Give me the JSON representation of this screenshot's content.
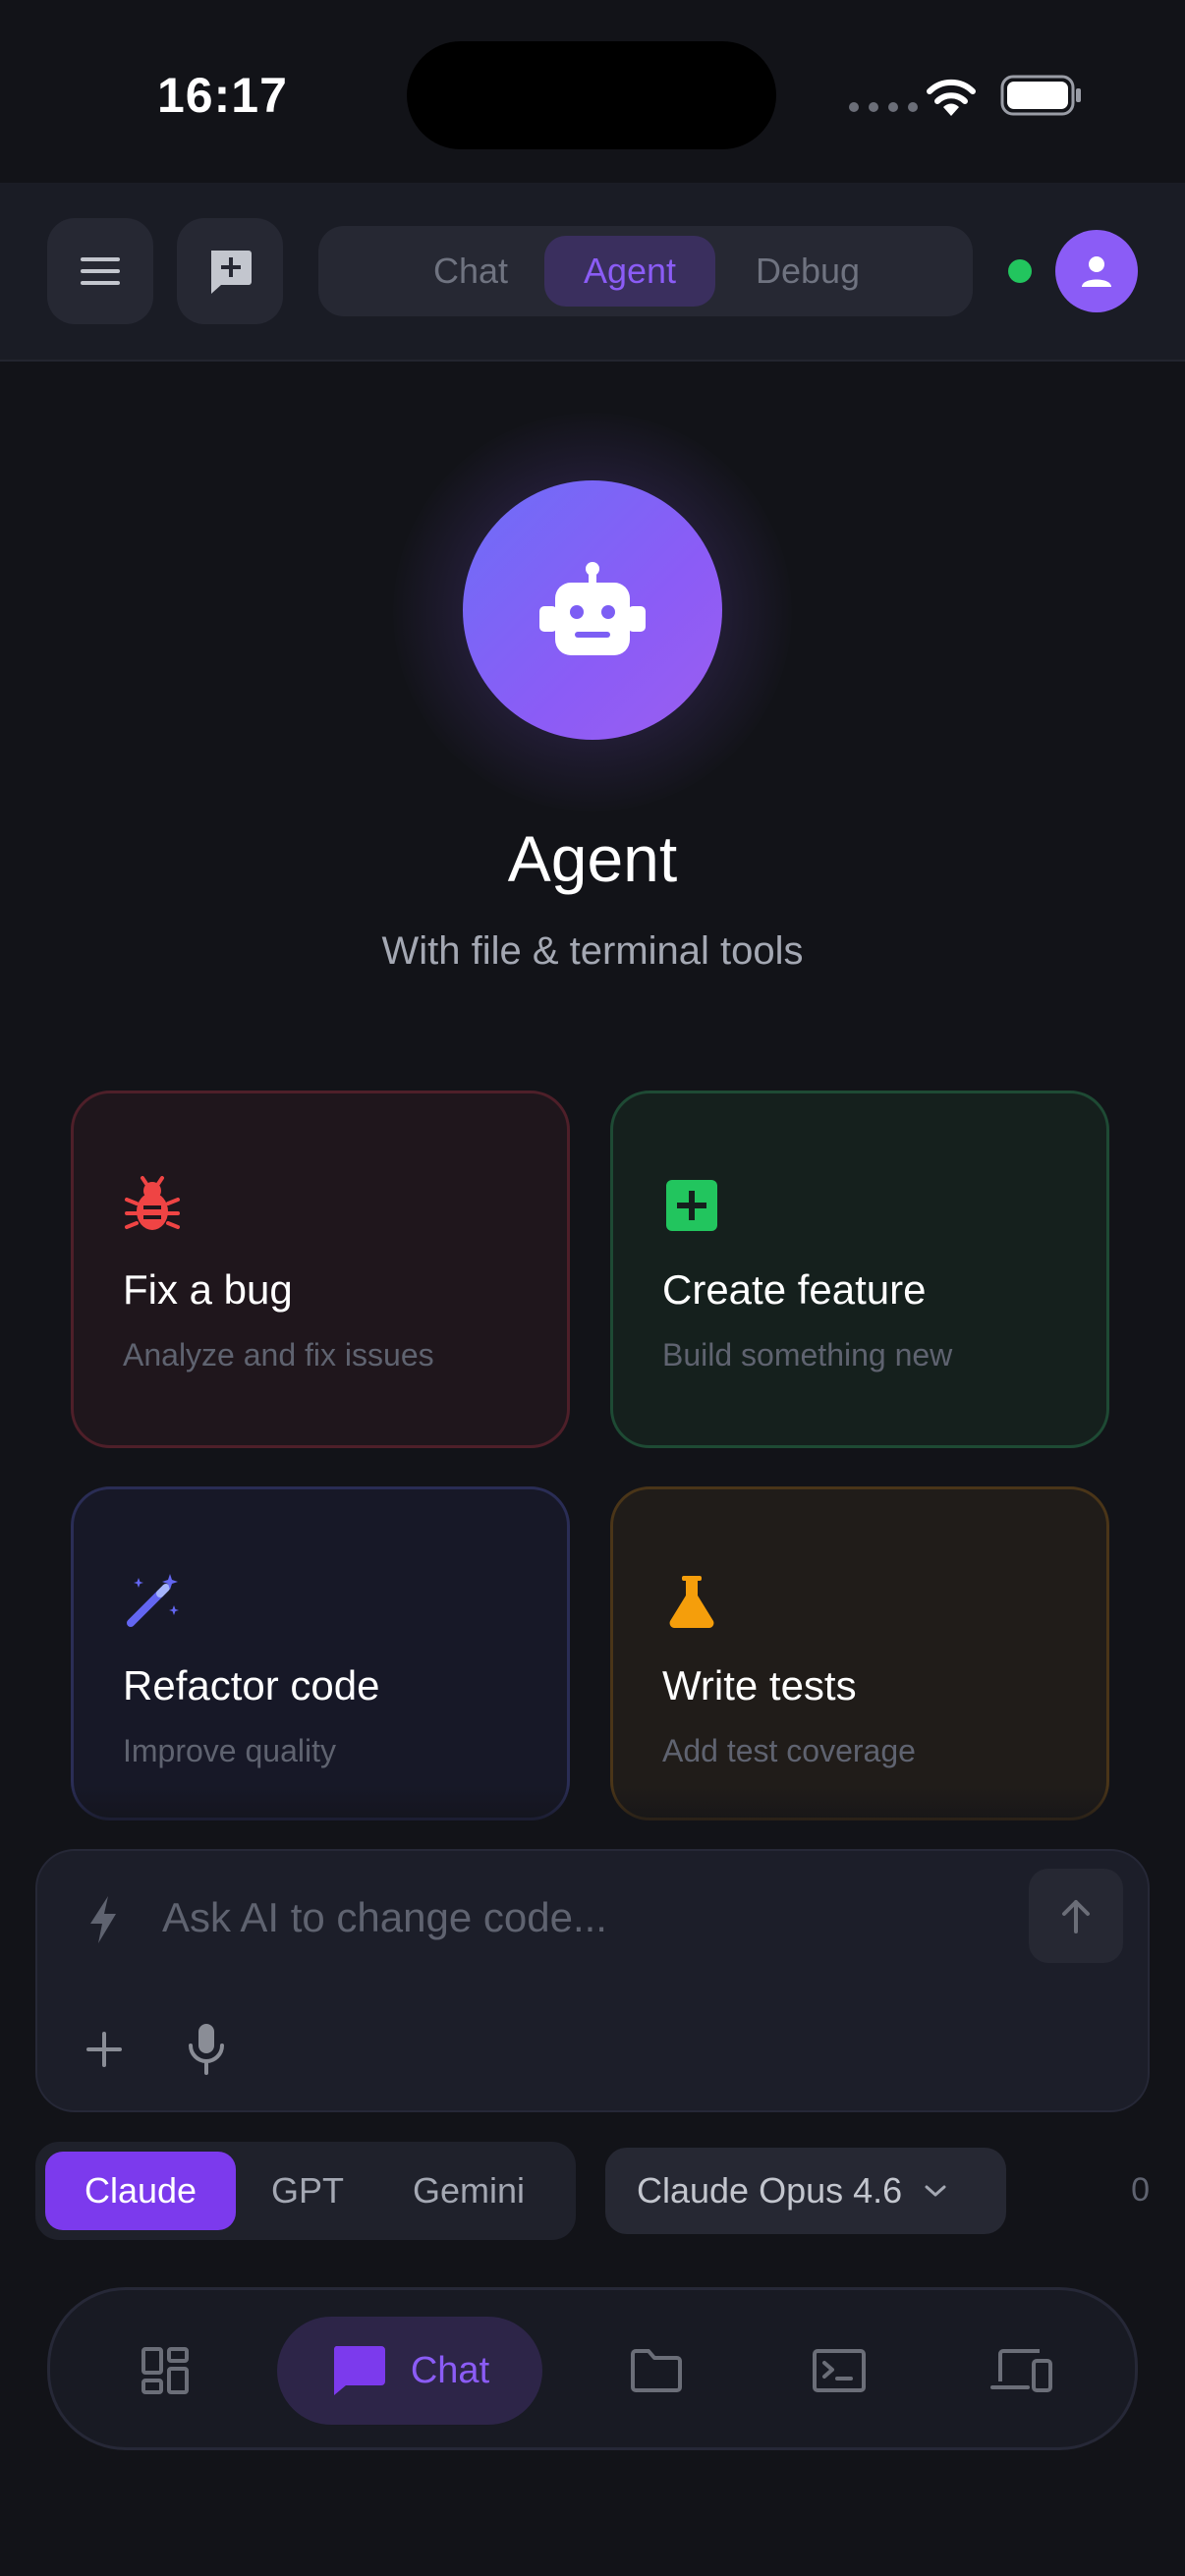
{
  "status_bar": {
    "time": "16:17"
  },
  "header": {
    "menu_icon": "hamburger-icon",
    "new_chat_icon": "new-chat-icon",
    "modes": [
      "Chat",
      "Agent",
      "Debug"
    ],
    "active_mode": "Agent",
    "online_status_color": "#22c55e",
    "avatar_icon": "user-icon"
  },
  "hero": {
    "icon": "robot-icon",
    "title": "Agent",
    "subtitle": "With file & terminal tools"
  },
  "cards": [
    {
      "title": "Fix a bug",
      "subtitle": "Analyze and fix issues",
      "icon": "bug-icon",
      "accent": "#ef4444"
    },
    {
      "title": "Create feature",
      "subtitle": "Build something new",
      "icon": "plus-square-icon",
      "accent": "#22c55e"
    },
    {
      "title": "Refactor code",
      "subtitle": "Improve quality",
      "icon": "magic-wand-icon",
      "accent": "#6366f1"
    },
    {
      "title": "Write tests",
      "subtitle": "Add test coverage",
      "icon": "flask-icon",
      "accent": "#f59e0b"
    }
  ],
  "input": {
    "placeholder": "Ask AI to change code...",
    "lead_icon": "lightning-icon",
    "attach_icon": "plus-icon",
    "mic_icon": "microphone-icon",
    "send_icon": "arrow-up-icon"
  },
  "providers": {
    "items": [
      "Claude",
      "GPT",
      "Gemini"
    ],
    "active": "Claude"
  },
  "model": {
    "selected": "Claude Opus 4.6",
    "icon": "chevron-down-icon"
  },
  "counter": "0",
  "bottom_nav": {
    "items": [
      {
        "icon": "dashboard-icon",
        "label": ""
      },
      {
        "icon": "chat-bubble-icon",
        "label": "Chat"
      },
      {
        "icon": "folder-icon",
        "label": ""
      },
      {
        "icon": "terminal-icon",
        "label": ""
      },
      {
        "icon": "devices-icon",
        "label": ""
      }
    ],
    "active": "Chat"
  },
  "colors": {
    "accent": "#8b5cf6",
    "background": "#121318"
  }
}
